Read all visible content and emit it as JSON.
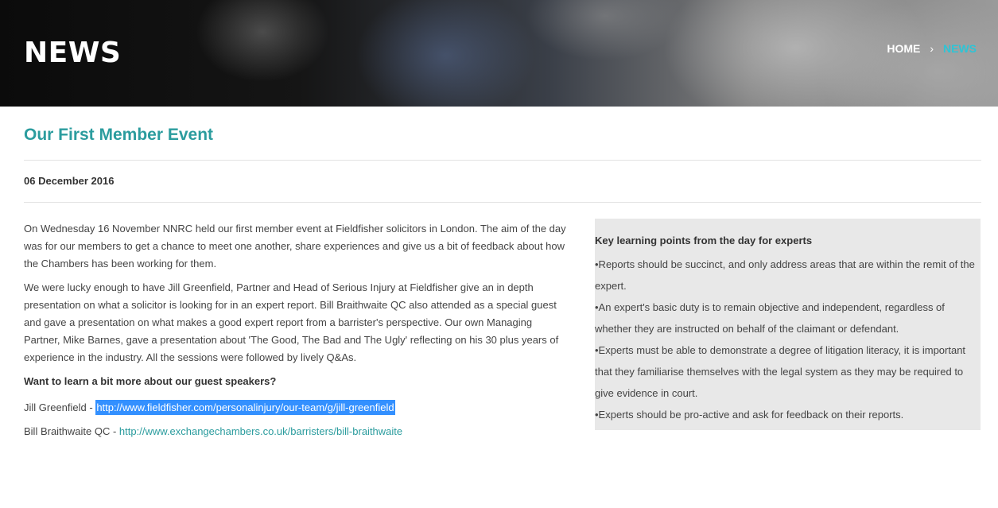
{
  "hero": {
    "title": "NEWS",
    "breadcrumb": {
      "home": "HOME",
      "separator": "›",
      "current": "NEWS"
    }
  },
  "article": {
    "title": "Our First Member Event",
    "date": "06 December 2016",
    "paragraphs": [
      "On Wednesday 16 November NNRC held our first member event at Fieldfisher solicitors in London. The aim of the day was for our members to get a chance to meet one another, share experiences and give us a bit of feedback about how the Chambers has been working for them.",
      "We were lucky enough to have Jill Greenfield, Partner and Head of Serious Injury at Fieldfisher give an in depth presentation on what a solicitor is looking for in an expert report. Bill Braithwaite QC also attended as a special guest and gave a presentation on what makes a good expert report from a barrister's perspective. Our own Managing Partner, Mike Barnes, gave a presentation about 'The Good, The Bad and The Ugly' reflecting on his 30 plus years of experience in the industry. All the sessions were followed by lively Q&As."
    ],
    "subheading": "Want to learn a bit more about our guest speakers?",
    "speakers": [
      {
        "name": "Jill Greenfield - ",
        "url": "http://www.fieldfisher.com/personalinjury/our-team/g/jill-greenfield"
      },
      {
        "name": "Bill Braithwaite QC - ",
        "url": "http://www.exchangechambers.co.uk/barristers/bill-braithwaite"
      }
    ]
  },
  "sidebar": {
    "title": "Key learning points from the day for experts",
    "points": [
      "•Reports should be succinct, and only address areas that are within the remit of the expert.",
      "•An expert's basic duty is to remain objective and independent, regardless of whether they are instructed on behalf of the claimant or defendant.",
      "•Experts must be able to demonstrate a degree of litigation literacy, it is important that they familiarise themselves with the legal system as they may be required to give evidence in court.",
      "•Experts should be pro-active and ask for feedback on their reports."
    ]
  },
  "colors": {
    "accent": "#2b9c9e",
    "breadcrumb_active": "#2ec4d6",
    "selection": "#3390ff",
    "sidebar_bg": "#e8e8e8"
  }
}
